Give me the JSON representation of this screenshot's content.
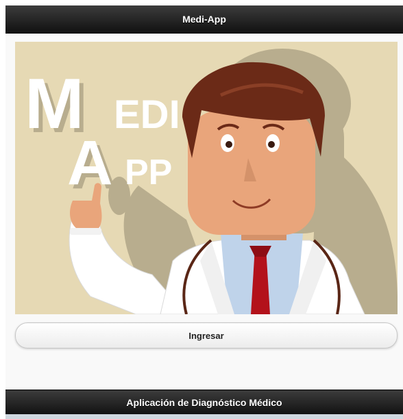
{
  "header": {
    "title": "Medi-App"
  },
  "hero": {
    "logo_line1_initial": "M",
    "logo_line1_rest": "EDI",
    "logo_line2_initial": "A",
    "logo_line2_rest": "PP",
    "colors": {
      "background": "#e6d9b4",
      "shadow": "#b8ad8e",
      "hair": "#6b2a17",
      "skin": "#e9a57b",
      "coat": "#ffffff",
      "shirt": "#bfd3ea",
      "tie": "#b3121b"
    },
    "illustration": "doctor-illustration"
  },
  "actions": {
    "enter_label": "Ingresar"
  },
  "footer": {
    "text": "Aplicación de Diagnóstico Médico"
  }
}
